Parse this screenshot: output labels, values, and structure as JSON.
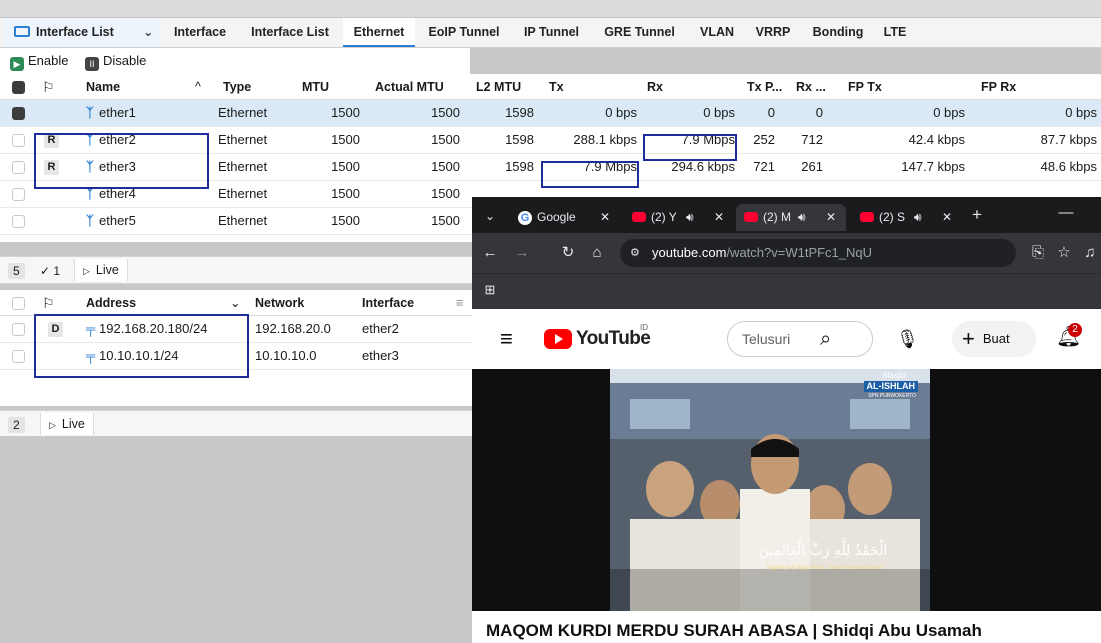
{
  "tabs": {
    "panel_title": "Interface List",
    "items": [
      "Interface",
      "Interface List",
      "Ethernet",
      "EoIP Tunnel",
      "IP Tunnel",
      "GRE Tunnel",
      "VLAN",
      "VRRP",
      "Bonding",
      "LTE"
    ],
    "active": "Ethernet"
  },
  "actions": {
    "enable": "Enable",
    "disable": "Disable"
  },
  "interfaces": {
    "headers": [
      "Name",
      "Type",
      "MTU",
      "Actual MTU",
      "L2 MTU",
      "Tx",
      "Rx",
      "Tx P...",
      "Rx ...",
      "FP Tx",
      "FP Rx"
    ],
    "rows": [
      {
        "flag": "",
        "name": "ether1",
        "type": "Ethernet",
        "mtu": "1500",
        "actual_mtu": "1500",
        "l2_mtu": "1598",
        "tx": "0 bps",
        "rx": "0 bps",
        "tx_p": "0",
        "rx_p": "0",
        "fp_tx": "0 bps",
        "fp_rx": "0 bps",
        "selected": true
      },
      {
        "flag": "R",
        "name": "ether2",
        "type": "Ethernet",
        "mtu": "1500",
        "actual_mtu": "1500",
        "l2_mtu": "1598",
        "tx": "288.1 kbps",
        "rx": "7.9 Mbps",
        "tx_p": "252",
        "rx_p": "712",
        "fp_tx": "42.4 kbps",
        "fp_rx": "87.7 kbps"
      },
      {
        "flag": "R",
        "name": "ether3",
        "type": "Ethernet",
        "mtu": "1500",
        "actual_mtu": "1500",
        "l2_mtu": "1598",
        "tx": "7.9 Mbps",
        "rx": "294.6 kbps",
        "tx_p": "721",
        "rx_p": "261",
        "fp_tx": "147.7 kbps",
        "fp_rx": "48.6 kbps"
      },
      {
        "flag": "",
        "name": "ether4",
        "type": "Ethernet",
        "mtu": "1500",
        "actual_mtu": "1500"
      },
      {
        "flag": "",
        "name": "ether5",
        "type": "Ethernet",
        "mtu": "1500",
        "actual_mtu": "1500"
      }
    ],
    "count": "5",
    "count_suffix": "✓ 1",
    "live": "Live"
  },
  "addresses": {
    "headers": [
      "Address",
      "Network",
      "Interface"
    ],
    "rows": [
      {
        "flag": "D",
        "address": "192.168.20.180/24",
        "network": "192.168.20.0",
        "interface": "ether2"
      },
      {
        "flag": "",
        "address": "10.10.10.1/24",
        "network": "10.10.10.0",
        "interface": "ether3"
      }
    ],
    "count": "2",
    "live": "Live"
  },
  "browser": {
    "tabs": [
      "Google",
      "(2) Y",
      "(2) M",
      "(2) S"
    ],
    "url_host": "youtube.com",
    "url_path": "/watch?v=W1tPFc1_NqU",
    "yt_brand": "YouTube",
    "yt_region": "ID",
    "search_placeholder": "Telusuri",
    "create_label": "Buat",
    "notif_count": "2",
    "video_title": "MAQOM KURDI MERDU SURAH ABASA | Shidqi Abu Usamah",
    "overlay_arabic": "الْحَمْدُ لِلَّهِ رَبِّ الْعَالَمِينَ",
    "overlay_subtitle": "Segala puji bagi Allah, Tuhan semesta alam.",
    "watermark_small": "Masjid",
    "watermark": "AL-ISHLAH",
    "watermark_sub": "SPN PURWOKERTO"
  },
  "colors": {
    "accent": "#2b7fd4",
    "highlight": "#1f2d9c",
    "yt_red": "#ff0000"
  }
}
